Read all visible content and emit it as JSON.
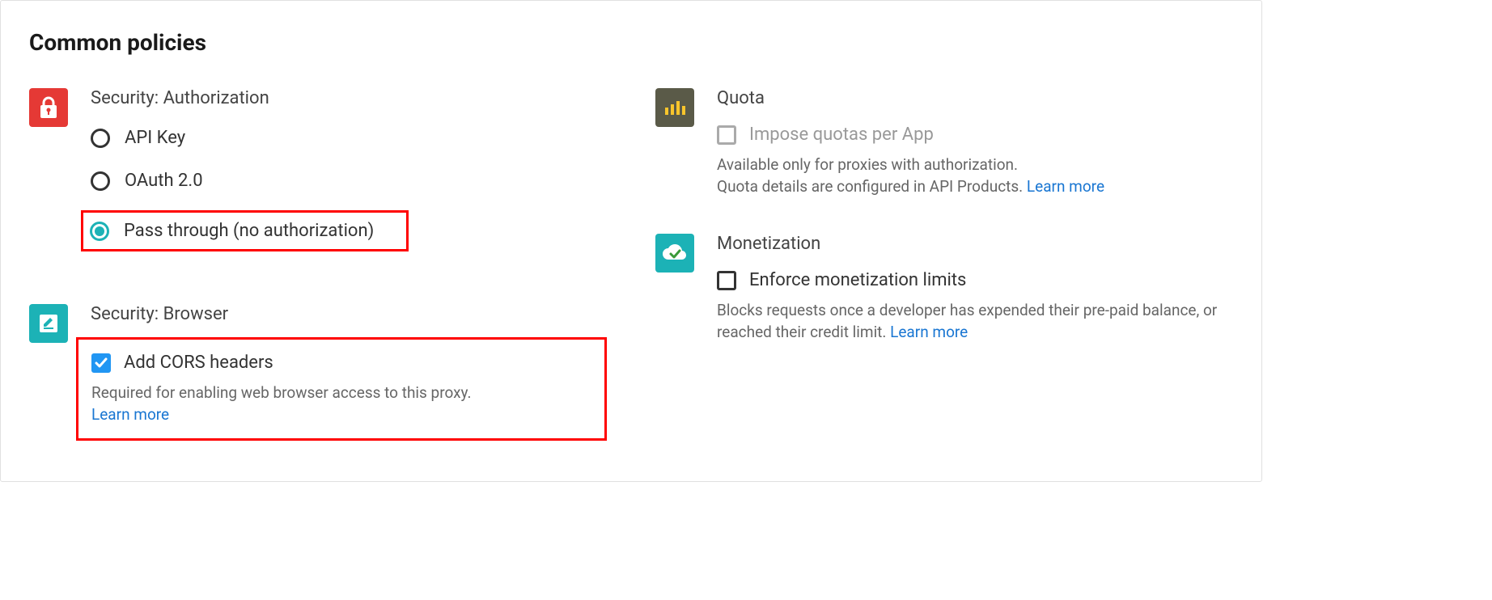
{
  "heading": "Common policies",
  "security_auth": {
    "title": "Security: Authorization",
    "options": {
      "api_key": "API Key",
      "oauth": "OAuth 2.0",
      "passthrough": "Pass through (no authorization)"
    }
  },
  "security_browser": {
    "title": "Security: Browser",
    "checkbox_label": "Add CORS headers",
    "desc": "Required for enabling web browser access to this proxy.",
    "learn_more": "Learn more"
  },
  "quota": {
    "title": "Quota",
    "checkbox_label": "Impose quotas per App",
    "desc1": "Available only for proxies with authorization.",
    "desc2": "Quota details are configured in API Products. ",
    "learn_more": "Learn more"
  },
  "monetization": {
    "title": "Monetization",
    "checkbox_label": "Enforce monetization limits",
    "desc": "Blocks requests once a developer has expended their pre-paid balance, or reached their credit limit. ",
    "learn_more": "Learn more"
  }
}
